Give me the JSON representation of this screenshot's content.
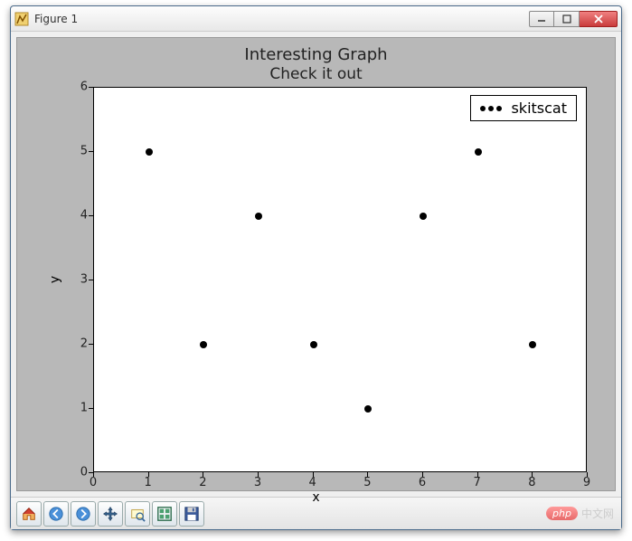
{
  "window": {
    "title": "Figure 1"
  },
  "chart_data": {
    "type": "scatter",
    "title": "Interesting Graph",
    "subtitle": "Check it out",
    "xlabel": "x",
    "ylabel": "y",
    "xlim": [
      0,
      9
    ],
    "ylim": [
      0,
      6
    ],
    "xticks": [
      0,
      1,
      2,
      3,
      4,
      5,
      6,
      7,
      8,
      9
    ],
    "yticks": [
      0,
      1,
      2,
      3,
      4,
      5,
      6
    ],
    "series": [
      {
        "name": "skitscat",
        "x": [
          1,
          2,
          3,
          4,
          5,
          6,
          7,
          8
        ],
        "y": [
          5,
          2,
          4,
          2,
          1,
          4,
          5,
          2
        ]
      }
    ],
    "legend_position": "upper right"
  },
  "toolbar": {
    "items": [
      "home",
      "back",
      "forward",
      "pan",
      "zoom",
      "configure",
      "save"
    ]
  },
  "watermark": {
    "badge": "php",
    "text": "中文网"
  }
}
